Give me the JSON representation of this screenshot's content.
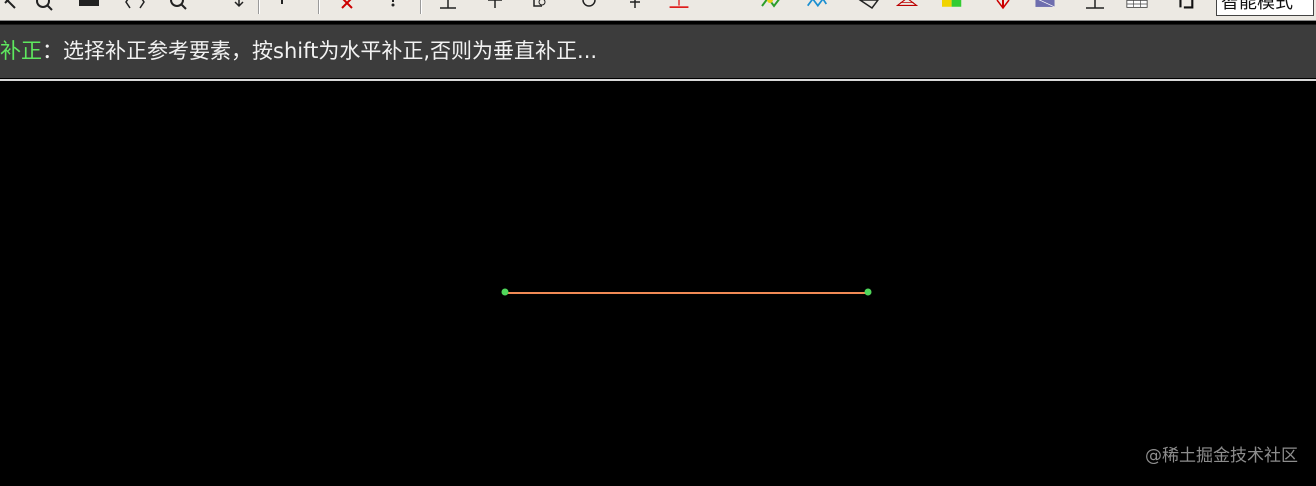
{
  "toolbar": {
    "mode_select_value": "智能模式",
    "icons": [
      "zoom-tool-icon",
      "zoom-in-icon",
      "keyboard-icon",
      "undo-redo-icon",
      "zoom-window-icon",
      "pan-icon",
      "pick-icon",
      "delete-icon",
      "point-icon",
      "line-icon",
      "text-icon",
      "circle-icon",
      "cross-icon",
      "underline-icon",
      "layer-icon",
      "hatch-icon",
      "measure-icon",
      "triangle-icon",
      "color-swatch-icon",
      "arrow-icon",
      "area-icon",
      "baseline-icon",
      "table-icon",
      "settings-icon"
    ]
  },
  "prompt": {
    "command": "补正",
    "separator": "：",
    "message": "选择补正参考要素，按shift为水平补正,否则为垂直补正..."
  },
  "canvas": {
    "background": "#000000",
    "line_color": "#f08a55",
    "endpoint_color": "#4fd65a"
  },
  "watermark": "@稀土掘金技术社区"
}
